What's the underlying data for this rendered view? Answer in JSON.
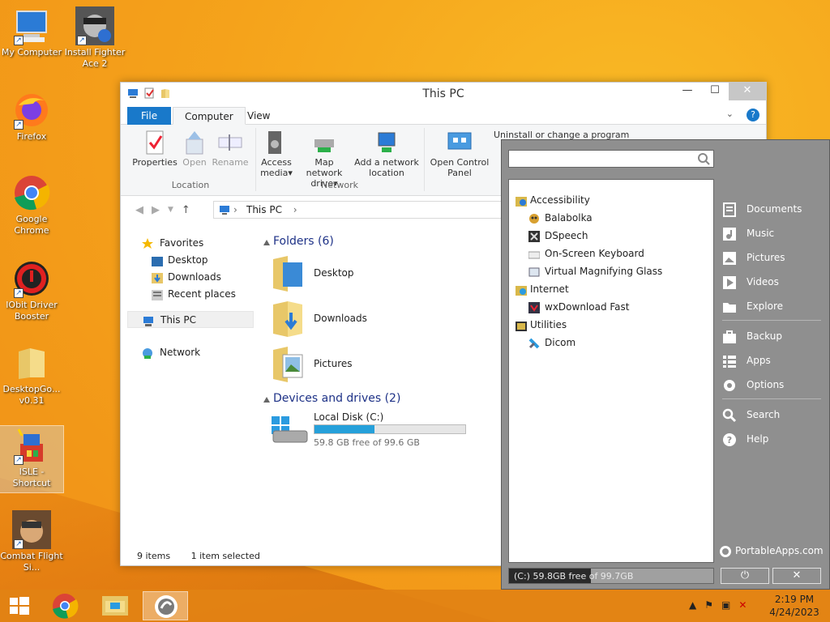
{
  "desktop": {
    "icons": [
      {
        "label": "My Computer"
      },
      {
        "label": "Install Fighter Ace 2"
      },
      {
        "label": "Firefox"
      },
      {
        "label": "Google Chrome"
      },
      {
        "label": "IObit Driver Booster"
      },
      {
        "label": "DesktopGo... v0.31"
      },
      {
        "label": "ISLE - Shortcut"
      },
      {
        "label": "Combat Flight Si..."
      }
    ]
  },
  "explorer": {
    "title": "This PC",
    "tabs": {
      "file": "File",
      "computer": "Computer",
      "view": "View"
    },
    "ribbon": {
      "properties": "Properties",
      "open": "Open",
      "rename": "Rename",
      "access_media": "Access media",
      "map_network_drive": "Map network drive",
      "add_network_location": "Add a network location",
      "open_control_panel": "Open Control Panel",
      "uninstall": "Uninstall or change a program",
      "group_location": "Location",
      "group_network": "Network"
    },
    "address": {
      "path": "This PC"
    },
    "nav": {
      "favorites": "Favorites",
      "desktop": "Desktop",
      "downloads": "Downloads",
      "recent_places": "Recent places",
      "this_pc": "This PC",
      "network": "Network"
    },
    "folders_header": "Folders (6)",
    "folders": [
      "Desktop",
      "Downloads",
      "Pictures"
    ],
    "devices_header": "Devices and drives (2)",
    "drive": {
      "name": "Local Disk (C:)",
      "free_text": "59.8 GB free of 99.6 GB",
      "used_fraction": 0.4
    },
    "status": {
      "items": "9 items",
      "selected": "1 item selected"
    }
  },
  "portableapps": {
    "search_placeholder": "",
    "categories": [
      {
        "name": "Accessibility",
        "apps": [
          "Balabolka",
          "DSpeech",
          "On-Screen Keyboard",
          "Virtual Magnifying Glass"
        ]
      },
      {
        "name": "Internet",
        "apps": [
          "wxDownload Fast"
        ]
      },
      {
        "name": "Utilities",
        "apps": [
          "Dicom"
        ]
      }
    ],
    "menu": {
      "documents": "Documents",
      "music": "Music",
      "pictures": "Pictures",
      "videos": "Videos",
      "explore": "Explore",
      "backup": "Backup",
      "apps": "Apps",
      "options": "Options",
      "search": "Search",
      "help": "Help"
    },
    "brand": "PortableApps.com",
    "free_space": {
      "text": "(C:) 59.8GB free of 99.7GB",
      "used_fraction": 0.4
    },
    "power_glyph": "⏻",
    "close_glyph": "✕"
  },
  "taskbar": {
    "clock_time": "2:19 PM",
    "clock_date": "4/24/2023"
  },
  "colors": {
    "accent": "#1979ca",
    "pa_bg": "#8f8f8f",
    "drive_bar": "#26a0da"
  }
}
